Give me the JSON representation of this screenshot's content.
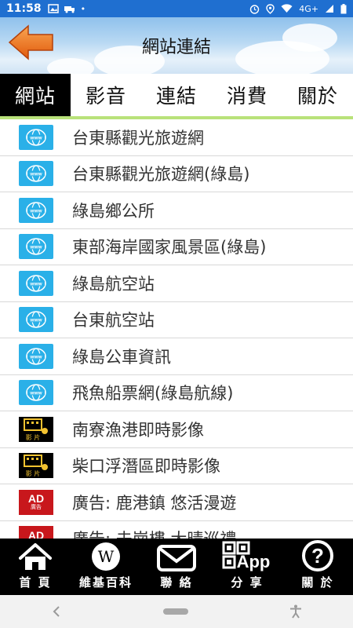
{
  "status_bar": {
    "time": "11:58",
    "network": "4G+"
  },
  "header": {
    "title": "網站連結",
    "back_icon": "back-arrow-icon"
  },
  "tabs": [
    {
      "label": "網站",
      "active": true
    },
    {
      "label": "影音",
      "active": false
    },
    {
      "label": "連結",
      "active": false
    },
    {
      "label": "消費",
      "active": false
    },
    {
      "label": "關於",
      "active": false
    }
  ],
  "list": {
    "items": [
      {
        "label": "台東縣觀光旅遊網",
        "icon": "www-icon"
      },
      {
        "label": "台東縣觀光旅遊網(綠島)",
        "icon": "www-icon"
      },
      {
        "label": "綠島鄉公所",
        "icon": "www-icon"
      },
      {
        "label": "東部海岸國家風景區(綠島)",
        "icon": "www-icon"
      },
      {
        "label": "綠島航空站",
        "icon": "www-icon"
      },
      {
        "label": "台東航空站",
        "icon": "www-icon"
      },
      {
        "label": "綠島公車資訊",
        "icon": "www-icon"
      },
      {
        "label": "飛魚船票網(綠島航線)",
        "icon": "www-icon"
      },
      {
        "label": "南寮漁港即時影像",
        "icon": "camera-icon",
        "icon_text": "影 片"
      },
      {
        "label": "柴口浮潛區即時影像",
        "icon": "camera-icon",
        "icon_text": "影 片"
      },
      {
        "label": "廣告: 鹿港鎮 悠活漫遊",
        "icon": "ad-icon",
        "icon_big": "AD",
        "icon_text": "廣告"
      },
      {
        "label": "廣告: 未崗樓 大晴巡禮",
        "icon": "ad-icon",
        "icon_big": "AD",
        "icon_text": "廣告"
      }
    ]
  },
  "bottom_nav": [
    {
      "label": "首 頁",
      "icon": "home-icon"
    },
    {
      "label": "維基百科",
      "icon": "wikipedia-icon",
      "icon_text": "W"
    },
    {
      "label": "聯 絡",
      "icon": "mail-icon"
    },
    {
      "label": "分 享",
      "icon": "qr-app-icon",
      "icon_text": "App"
    },
    {
      "label": "關 於",
      "icon": "help-icon",
      "icon_text": "?"
    }
  ],
  "colors": {
    "status_bar": "#1f6fd0",
    "active_tab": "#000000",
    "tab_underline": "#b9e27a",
    "www_icon": "#2ab0e8",
    "ad_icon": "#c8171c",
    "back_arrow": "#f07a1a"
  }
}
